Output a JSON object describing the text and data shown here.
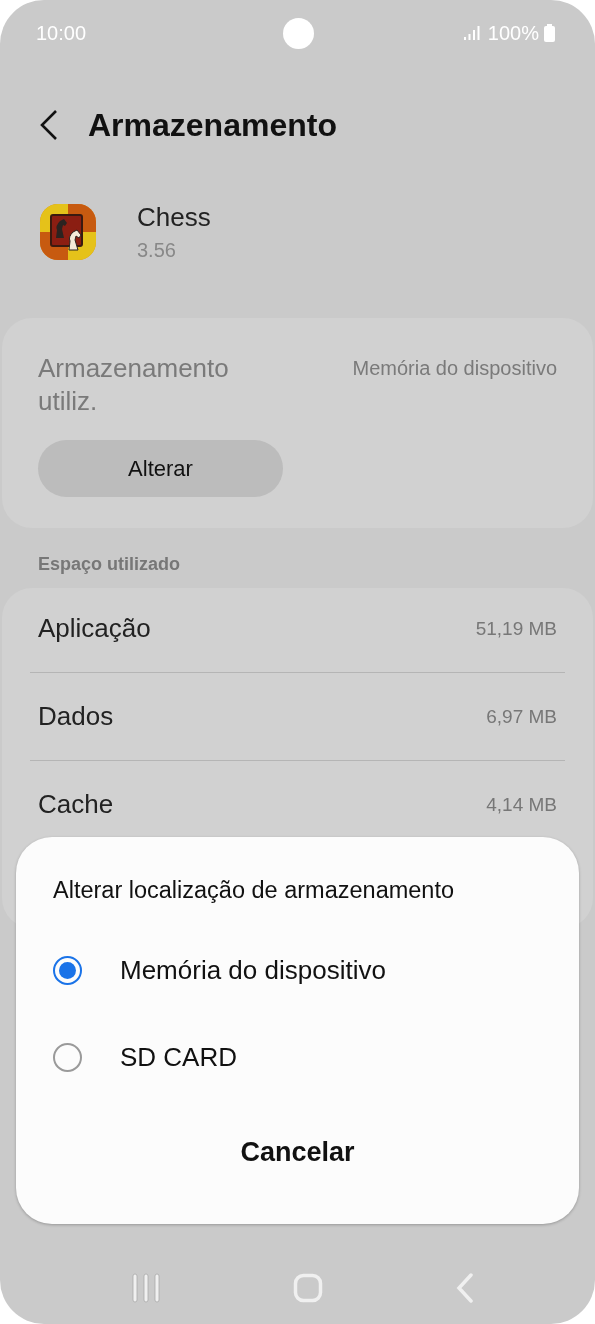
{
  "status_bar": {
    "time": "10:00",
    "battery": "100%"
  },
  "header": {
    "title": "Armazenamento"
  },
  "app": {
    "name": "Chess",
    "version": "3.56"
  },
  "storage_location": {
    "label": "Armazenamento utiliz.",
    "value": "Memória do dispositivo",
    "button": "Alterar"
  },
  "section_title": "Espaço utilizado",
  "usage": [
    {
      "label": "Aplicação",
      "value": "51,19 MB"
    },
    {
      "label": "Dados",
      "value": "6,97 MB"
    },
    {
      "label": "Cache",
      "value": "4,14 MB"
    }
  ],
  "dialog": {
    "title": "Alterar localização de armazenamento",
    "options": [
      {
        "label": "Memória do dispositivo",
        "selected": true
      },
      {
        "label": "SD CARD",
        "selected": false
      }
    ],
    "button": "Cancelar"
  }
}
